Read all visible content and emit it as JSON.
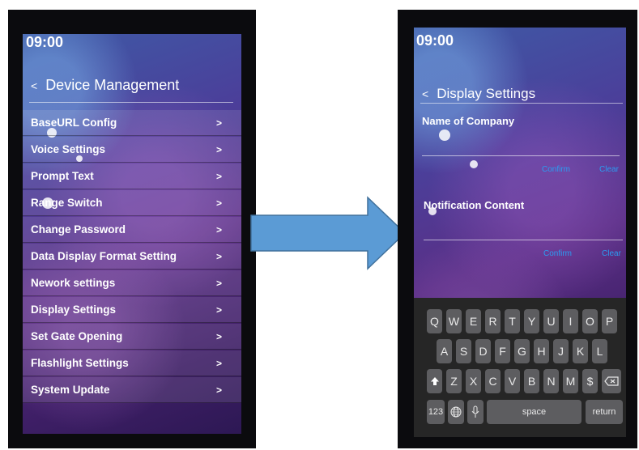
{
  "left_screen": {
    "time": "09:00",
    "back_glyph": "<",
    "title": "Device Management",
    "items": [
      {
        "label": "BaseURL Config",
        "chevron": ">"
      },
      {
        "label": "Voice Settings",
        "chevron": ">"
      },
      {
        "label": "Prompt Text",
        "chevron": ">"
      },
      {
        "label": "Range Switch",
        "chevron": ">"
      },
      {
        "label": "Change Password",
        "chevron": ">"
      },
      {
        "label": "Data Display Format Setting",
        "chevron": ">"
      },
      {
        "label": "Nework settings",
        "chevron": ">"
      },
      {
        "label": "Display Settings",
        "chevron": ">"
      },
      {
        "label": "Set Gate Opening",
        "chevron": ">"
      },
      {
        "label": "Flashlight Settings",
        "chevron": ">"
      },
      {
        "label": "System Update",
        "chevron": ">"
      }
    ]
  },
  "right_screen": {
    "time": "09:00",
    "back_glyph": "<",
    "title": "Display Settings",
    "company": {
      "label": "Name of Company",
      "confirm": "Confirm",
      "clear": "Clear"
    },
    "notification": {
      "label": "Notification Content",
      "confirm": "Confirm",
      "clear": "Clear"
    },
    "keyboard": {
      "row1": [
        "Q",
        "W",
        "E",
        "R",
        "T",
        "Y",
        "U",
        "I",
        "O",
        "P"
      ],
      "row2": [
        "A",
        "S",
        "D",
        "F",
        "G",
        "H",
        "J",
        "K",
        "L"
      ],
      "row3": [
        "Z",
        "X",
        "C",
        "V",
        "B",
        "N",
        "M",
        "$"
      ],
      "numbers_key": "123",
      "space_key": "space",
      "return_key": "return"
    }
  },
  "arrow": {
    "color": "#5b9bd5"
  }
}
